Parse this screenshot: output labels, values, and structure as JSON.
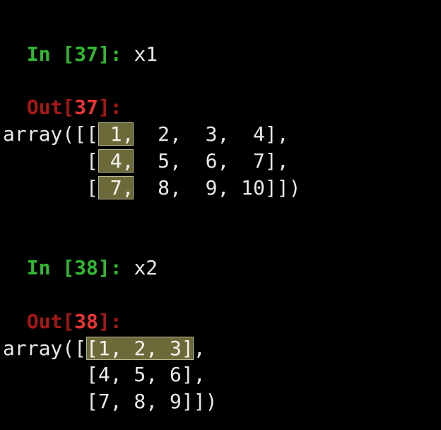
{
  "cells": [
    {
      "in_prefix": "In [",
      "in_number": "37",
      "in_suffix": "]: ",
      "expr": "x1",
      "out_prefix": "Out[",
      "out_number": "37",
      "out_suffix": "]:",
      "array_rows": {
        "r0": {
          "pre": "array([[",
          "hl": " 1,",
          "post": "  2,  3,  4],"
        },
        "r1": {
          "pre": "       [",
          "hl": " 4,",
          "post": "  5,  6,  7],"
        },
        "r2": {
          "pre": "       [",
          "hl": " 7,",
          "post": "  8,  9, 10]])"
        }
      }
    },
    {
      "in_prefix": "In [",
      "in_number": "38",
      "in_suffix": "]: ",
      "expr": "x2",
      "out_prefix": "Out[",
      "out_number": "38",
      "out_suffix": "]:",
      "array_rows": {
        "r0": {
          "pre": "array([",
          "hl": "[1, 2, 3]",
          "post": ","
        },
        "r1": {
          "pre": "       [4, 5, 6],",
          "hl": "",
          "post": ""
        },
        "r2": {
          "pre": "       [7, 8, 9]])",
          "hl": "",
          "post": ""
        }
      }
    }
  ]
}
